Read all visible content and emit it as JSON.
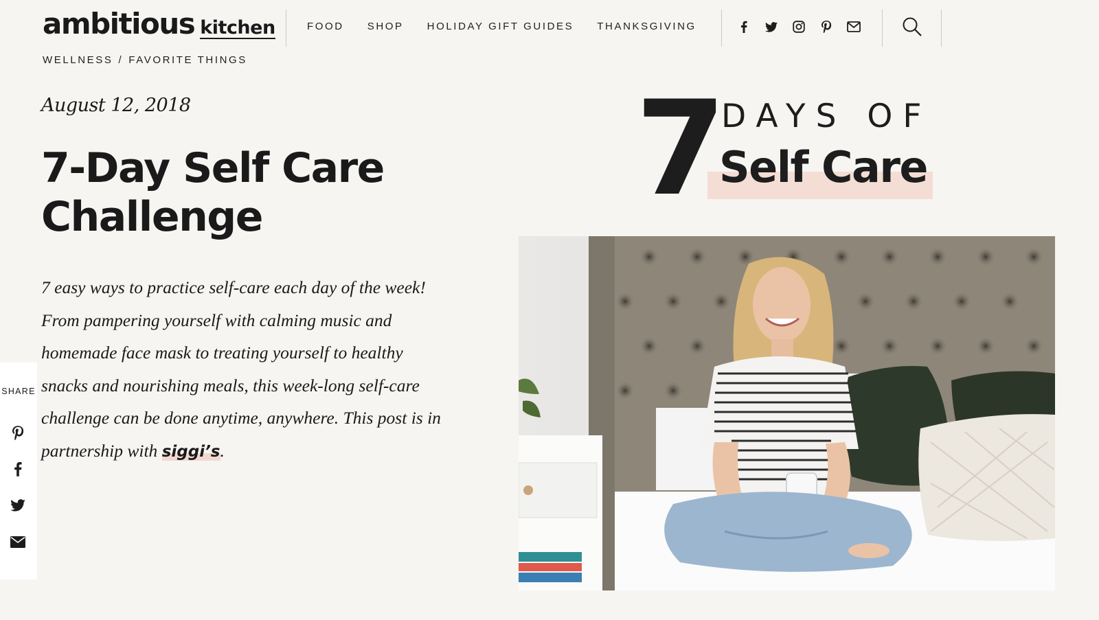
{
  "header": {
    "logo_main": "ambitious",
    "logo_sub": "kitchen",
    "nav": [
      "FOOD",
      "SHOP",
      "HOLIDAY GIFT GUIDES",
      "THANKSGIVING"
    ],
    "social_icons": [
      "facebook-icon",
      "twitter-icon",
      "instagram-icon",
      "pinterest-icon",
      "email-icon"
    ],
    "search_icon": "search-icon"
  },
  "breadcrumb": {
    "items": [
      "WELLNESS",
      "FAVORITE THINGS"
    ],
    "separator": "/"
  },
  "article": {
    "date": "August 12, 2018",
    "title_line1": "7-Day Self Care",
    "title_line2": "Challenge",
    "intro": "7 easy ways to practice self-care each day of the week! From pampering yourself with calming music and homemade face mask to treating yourself to healthy snacks and nourishing meals, this week-long self-care challenge can be done anytime, anywhere. This post is in partnership with ",
    "brand_link": "siggi’s",
    "intro_end": "."
  },
  "share": {
    "label": "SHARE",
    "icons": [
      "pinterest-icon",
      "facebook-icon",
      "twitter-icon",
      "email-icon"
    ]
  },
  "hero": {
    "number": "7",
    "days_of": "DAYS OF",
    "self_care": "Self Care"
  },
  "colors": {
    "background": "#f6f5f2",
    "text": "#1d1d1d",
    "highlight": "#f4ddd4",
    "divider": "#c9c9c9"
  }
}
